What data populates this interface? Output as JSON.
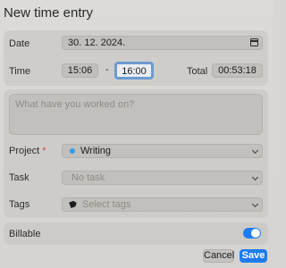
{
  "window": {
    "title": "New time entry"
  },
  "date": {
    "label": "Date",
    "value": "30. 12. 2024."
  },
  "time": {
    "label": "Time",
    "start": "15:06",
    "separator": "-",
    "end": "16:00",
    "total_label": "Total",
    "total": "00:53:18"
  },
  "notes": {
    "placeholder": "What have you worked on?"
  },
  "project": {
    "label": "Project",
    "required_mark": "*",
    "value": "Writing",
    "color": "#2f9cf0"
  },
  "task": {
    "label": "Task",
    "placeholder": "No task"
  },
  "tags": {
    "label": "Tags",
    "placeholder": "Select tags"
  },
  "billable": {
    "label": "Billable",
    "enabled": true,
    "accent": "#1f7cf0"
  },
  "buttons": {
    "cancel": "Cancel",
    "save": "Save"
  },
  "icons": [
    "calendar-icon",
    "chevron-down-icon",
    "tag-icon"
  ]
}
